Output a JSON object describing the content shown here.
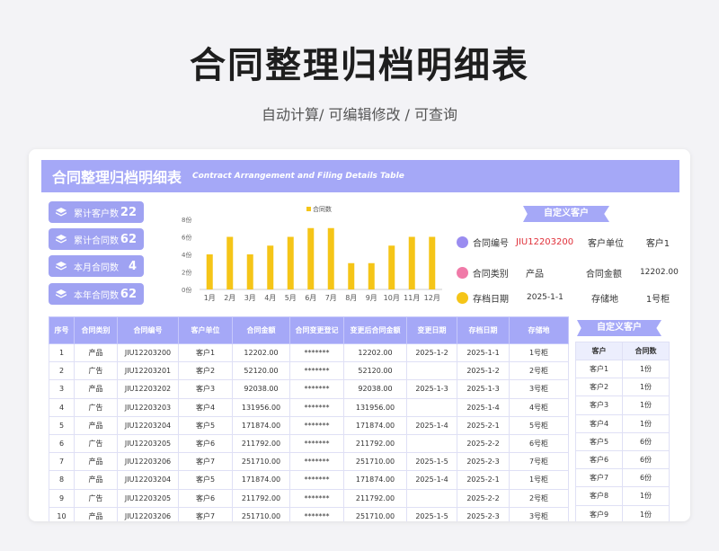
{
  "page": {
    "title": "合同整理归档明细表",
    "subtitle": "自动计算/ 可编辑修改 / 可查询"
  },
  "banner": {
    "title": "合同整理归档明细表",
    "en": "Contract Arrangement and Filing Details Table"
  },
  "stats": [
    {
      "label": "累计客户数",
      "value": "22"
    },
    {
      "label": "累计合同数",
      "value": "62"
    },
    {
      "label": "本月合同数",
      "value": "4"
    },
    {
      "label": "本年合同数",
      "value": "62"
    }
  ],
  "chart_data": {
    "type": "bar",
    "legend": "合同数",
    "categories": [
      "1月",
      "2月",
      "3月",
      "4月",
      "5月",
      "6月",
      "7月",
      "8月",
      "9月",
      "10月",
      "11月",
      "12月"
    ],
    "values": [
      4,
      6,
      4,
      5,
      6,
      7,
      7,
      3,
      3,
      5,
      6,
      6
    ],
    "yticks": [
      "0份",
      "2份",
      "4份",
      "6份",
      "8份"
    ],
    "ylim": [
      0,
      8
    ],
    "bar_color": "#f5c518"
  },
  "custom_ribbon_top": "自定义客户",
  "custom_ribbon_side": "自定义客户",
  "info": {
    "contract_no_label": "合同编号",
    "contract_no_value": "JIU12203200",
    "client_unit_label": "客户单位",
    "client_unit_value": "客户1",
    "contract_type_label": "合同类别",
    "contract_type_value": "产品",
    "amount_label": "合同金额",
    "amount_value": "12202.00",
    "archive_date_label": "存档日期",
    "archive_date_value": "2025-1-1",
    "storage_label": "存储地",
    "storage_value": "1号柜"
  },
  "table": {
    "headers": [
      "序号",
      "合同类别",
      "合同编号",
      "客户单位",
      "合同金额",
      "合同变更登记",
      "变更后合同金额",
      "变更日期",
      "存档日期",
      "存储地"
    ],
    "rows": [
      [
        "1",
        "产品",
        "JIU12203200",
        "客户1",
        "12202.00",
        "*******",
        "12202.00",
        "2025-1-2",
        "2025-1-1",
        "1号柜"
      ],
      [
        "2",
        "广告",
        "JIU12203201",
        "客户2",
        "52120.00",
        "*******",
        "52120.00",
        "",
        "2025-1-2",
        "2号柜"
      ],
      [
        "3",
        "产品",
        "JIU12203202",
        "客户3",
        "92038.00",
        "*******",
        "92038.00",
        "2025-1-3",
        "2025-1-3",
        "3号柜"
      ],
      [
        "4",
        "广告",
        "JIU12203203",
        "客户4",
        "131956.00",
        "*******",
        "131956.00",
        "",
        "2025-1-4",
        "4号柜"
      ],
      [
        "5",
        "产品",
        "JIU12203204",
        "客户5",
        "171874.00",
        "*******",
        "171874.00",
        "2025-1-4",
        "2025-2-1",
        "5号柜"
      ],
      [
        "6",
        "广告",
        "JIU12203205",
        "客户6",
        "211792.00",
        "*******",
        "211792.00",
        "",
        "2025-2-2",
        "6号柜"
      ],
      [
        "7",
        "产品",
        "JIU12203206",
        "客户7",
        "251710.00",
        "*******",
        "251710.00",
        "2025-1-5",
        "2025-2-3",
        "7号柜"
      ],
      [
        "8",
        "产品",
        "JIU12203204",
        "客户5",
        "171874.00",
        "*******",
        "171874.00",
        "2025-1-4",
        "2025-2-1",
        "1号柜"
      ],
      [
        "9",
        "广告",
        "JIU12203205",
        "客户6",
        "211792.00",
        "*******",
        "211792.00",
        "",
        "2025-2-2",
        "2号柜"
      ],
      [
        "10",
        "产品",
        "JIU12203206",
        "客户7",
        "251710.00",
        "*******",
        "251710.00",
        "2025-1-5",
        "2025-2-3",
        "3号柜"
      ]
    ]
  },
  "side_table": {
    "headers": [
      "客户",
      "合同数"
    ],
    "rows": [
      [
        "客户1",
        "1份"
      ],
      [
        "客户2",
        "1份"
      ],
      [
        "客户3",
        "1份"
      ],
      [
        "客户4",
        "1份"
      ],
      [
        "客户5",
        "6份"
      ],
      [
        "客户6",
        "6份"
      ],
      [
        "客户7",
        "6份"
      ],
      [
        "客户8",
        "1份"
      ],
      [
        "客户9",
        "1份"
      ]
    ]
  },
  "colors": {
    "accent": "#a5a8f7",
    "contract_no": "#e0303a",
    "dot1": "#9a8cf0",
    "dot2": "#f07aa8",
    "dot3": "#f5c518"
  }
}
